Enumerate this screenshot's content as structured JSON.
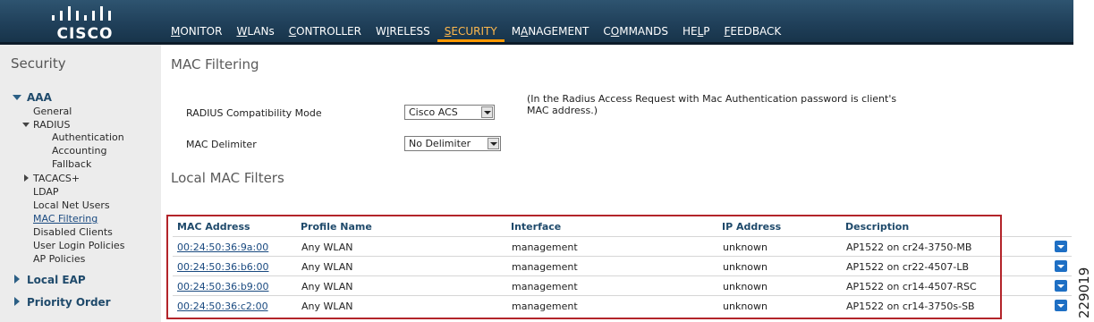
{
  "brand": {
    "logo_text": "CISCO"
  },
  "nav": {
    "items": [
      {
        "id": "monitor",
        "label": "MONITOR",
        "u": "M",
        "active": false
      },
      {
        "id": "wlans",
        "label": "WLANs",
        "u": "W",
        "active": false
      },
      {
        "id": "controller",
        "label": "CONTROLLER",
        "u": "C",
        "active": false
      },
      {
        "id": "wireless",
        "label": "WIRELESS",
        "u": "I",
        "active": false
      },
      {
        "id": "security",
        "label": "SECURITY",
        "u": "S",
        "active": true
      },
      {
        "id": "management",
        "label": "MANAGEMENT",
        "u": "A",
        "active": false
      },
      {
        "id": "commands",
        "label": "COMMANDS",
        "u": "O",
        "active": false
      },
      {
        "id": "help",
        "label": "HELP",
        "u": "L",
        "active": false
      },
      {
        "id": "feedback",
        "label": "FEEDBACK",
        "u": "F",
        "active": false
      }
    ],
    "active_color": "#ff9900"
  },
  "sidebar": {
    "title": "Security",
    "aaa": "AAA",
    "general": "General",
    "radius": "RADIUS",
    "authentication": "Authentication",
    "accounting": "Accounting",
    "fallback": "Fallback",
    "tacacs": "TACACS+",
    "ldap": "LDAP",
    "local_net_users": "Local Net Users",
    "mac_filtering": "MAC Filtering",
    "disabled_clients": "Disabled Clients",
    "user_login_policies": "User Login Policies",
    "ap_policies": "AP Policies",
    "local_eap": "Local EAP",
    "priority_order": "Priority Order"
  },
  "main": {
    "title": "MAC Filtering",
    "radius_mode_label": "RADIUS Compatibility Mode",
    "radius_mode_value": "Cisco ACS",
    "radius_note": "(In the Radius Access Request with Mac Authentication password is client's MAC address.)",
    "mac_delimiter_label": "MAC Delimiter",
    "mac_delimiter_value": "No Delimiter",
    "local_filters_title": "Local MAC Filters"
  },
  "table": {
    "columns": [
      "MAC Address",
      "Profile Name",
      "Interface",
      "IP Address",
      "Description"
    ],
    "rows": [
      [
        "00:24:50:36:9a:00",
        "Any WLAN",
        "management",
        "unknown",
        "AP1522 on cr24-3750-MB"
      ],
      [
        "00:24:50:36:b6:00",
        "Any WLAN",
        "management",
        "unknown",
        "AP1522 on cr22-4507-LB"
      ],
      [
        "00:24:50:36:b9:00",
        "Any WLAN",
        "management",
        "unknown",
        "AP1522 on cr14-4507-RSC"
      ],
      [
        "00:24:50:36:c2:00",
        "Any WLAN",
        "management",
        "unknown",
        "AP1522 on cr14-3750s-SB"
      ]
    ]
  },
  "figure_id": "229019",
  "colors": {
    "header": "#20405a",
    "sidebar": "#ececec",
    "highlight": "#b3242a",
    "link": "#1a4a80",
    "row_button": "#1e6fc4"
  }
}
